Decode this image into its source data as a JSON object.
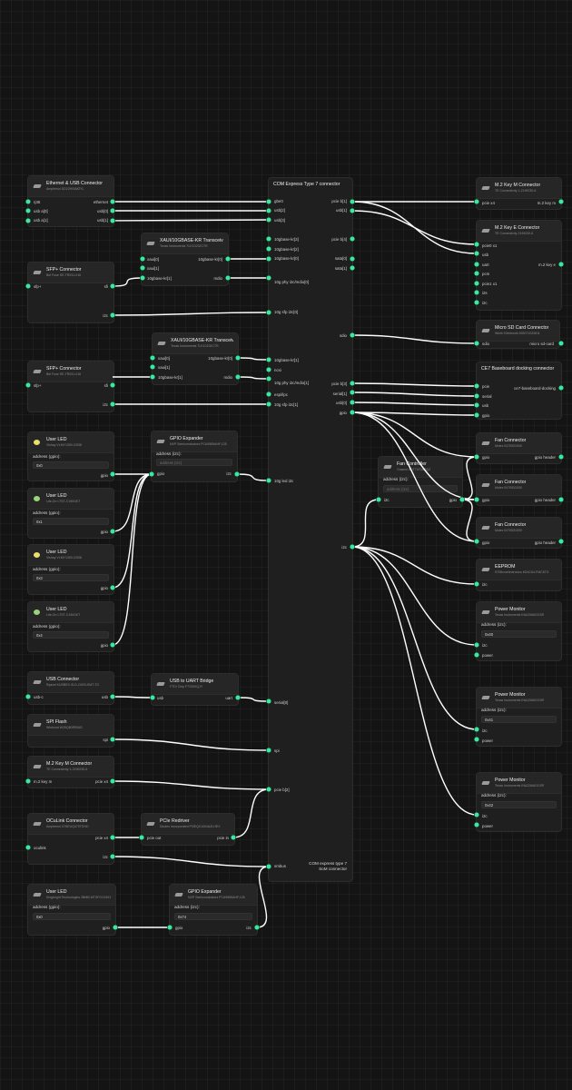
{
  "colors": {
    "wire": "#ffffff",
    "port": "#3ee6a0",
    "node_bg": "#1f1f1f",
    "canvas_bg": "#141414"
  },
  "nodes": {
    "com": {
      "title": "COM Express Type 7 connector",
      "left_ports": [
        "gbe0",
        "usb[2]",
        "usb[3]",
        "10gbase-kr[3]",
        "10gbase-kr[2]",
        "10gbase-kr[0]",
        "10g phy i2c/mdio[0]",
        "10g sfp i2c[0]",
        "10gbase-kr[1]",
        "ncsi",
        "10g phy i2c/mdio[1]",
        "espi/lpc",
        "10g sfp i2c[1]",
        "10g led i2c",
        "serial[0]",
        "spi",
        "pcie b[2]",
        "smbus"
      ],
      "right_ports": [
        "pcie b[1]",
        "usb[1]",
        "pcie b[4]",
        "sata[0]",
        "sata[1]",
        "sdio",
        "pcie b[3]",
        "serial[1]",
        "usb[0]",
        "gpio",
        "i2c"
      ],
      "footer": "COM express type 7 SoM connector"
    },
    "eth_usb": {
      "title": "Ethernet & USB Connector",
      "sub": "Amphenol DD22H04MZYL",
      "ports_left": [
        "rj45",
        "usb a[0]",
        "usb a[1]"
      ],
      "ports_right": [
        "ethernet",
        "usb[0]",
        "usb[1]"
      ]
    },
    "xaui0": {
      "title": "XAUI/10GBASE-KR Transceiver",
      "sub": "Texas Instruments TLK10232CTR",
      "ports_left": [
        "xaui[0]",
        "xaui[1]",
        "10gbase-kr[1]"
      ],
      "ports_right": [
        "10gbase-kr[0]",
        "mdio"
      ]
    },
    "sfp0": {
      "title": "SFP+ Connector",
      "sub": "Bel Fuse SE-TR031-016",
      "port_left": "sfp+",
      "ports_right": [
        "sfi",
        "i2c"
      ]
    },
    "xaui1": {
      "title": "XAUI/10GBASE-KR Transceiver",
      "sub": "Texas Instruments TLK10232CTR",
      "ports_left": [
        "xaui[0]",
        "xaui[1]",
        "10gbase-kr[1]"
      ],
      "ports_right": [
        "10gbase-kr[0]",
        "mdio"
      ]
    },
    "sfp1": {
      "title": "SFP+ Connector",
      "sub": "Bel Fuse SE-TR031-016",
      "port_left": "sfp+",
      "ports_right": [
        "sfi",
        "i2c"
      ]
    },
    "led1": {
      "title": "User LED",
      "sub": "Vishay VLMY1300-GS08",
      "label": "address (gpio):",
      "value": "0x0",
      "port": "gpio"
    },
    "gpioexp1": {
      "title": "GPIO Expander",
      "sub": "NXP Semiconductors PCA9555AHF,128",
      "label": "address (i2c):",
      "placeholder": "address (i2c)",
      "port_left": "gpio",
      "port_right": "i2c"
    },
    "led2": {
      "title": "User LED",
      "sub": "Lite-On LTST-C190GKT",
      "label": "address (gpio):",
      "value": "0x1",
      "port": "gpio"
    },
    "led3": {
      "title": "User LED",
      "sub": "Vishay VLMY1300-GS08",
      "label": "address (gpio):",
      "value": "0x3",
      "port": "gpio"
    },
    "led4": {
      "title": "User LED",
      "sub": "Lite-On LTST-C190GKT",
      "label": "address (gpio):",
      "value": "0x4",
      "port": "gpio"
    },
    "usbconn": {
      "title": "USB Connector",
      "sub": "Ryacel KUSBEX-SLD-CMSI-SMT-TO",
      "port_left": "usb-c",
      "port_right": "usb"
    },
    "usbuart": {
      "title": "USB to UART Bridge",
      "sub": "FTDI Chip FT230XQ-R",
      "port_left": "usb",
      "port_right": "uart"
    },
    "spiflash": {
      "title": "SPI Flash",
      "sub": "Winbond W25Q80RSNIG",
      "port_right": "spi"
    },
    "m2m_left": {
      "title": "M.2 Key M Connector",
      "sub": "TE Connectivity 1-2199230-6",
      "port_left": "m.2 key m",
      "port_right": "pcie x4"
    },
    "oculink": {
      "title": "OCuLink Connector",
      "sub": "Amphenol G76EUQ470TDHD",
      "port_left": "oculink",
      "ports_right": [
        "pcie x4",
        "i2c"
      ]
    },
    "redriver": {
      "title": "PCIe Redriver",
      "sub": "Diodes Incorporated PI3EQX1004AZLHEX",
      "port_left": "pcie out",
      "port_right": "pcie in"
    },
    "led5": {
      "title": "User LED",
      "sub": "Kingbright Technologies 2BMB-MTSFO1X401",
      "label": "address (gpio):",
      "value": "0x0",
      "port": "gpio"
    },
    "gpioexp2": {
      "title": "GPIO Expander",
      "sub": "NXP Semiconductors PCA9555AHF,128",
      "label": "address (i2c):",
      "value": "0x74",
      "port_left": "gpio",
      "port_right": "i2c"
    },
    "m2m_right": {
      "title": "M.2 Key M Connector",
      "sub": "TE Connectivity 1-2199230-6",
      "port_left": "pcie x4",
      "port_right": "m.2 key m"
    },
    "m2e": {
      "title": "M.2 Key E Connector",
      "sub": "TE Connectivity 2199230-6",
      "ports_left": [
        "pcie0 x1",
        "usb",
        "uart",
        "pcm",
        "pcie1 x1",
        "i2s",
        "i2c"
      ],
      "port_right": "m.2 key e"
    },
    "sdcard": {
      "title": "Micro SD Card Connector",
      "sub": "Würth Elektronik 693071020811",
      "port_left": "sdio",
      "port_right": "micro sd-card"
    },
    "ce7": {
      "title": "CE7 Baseboard docking connector",
      "ports_left": [
        "pcie",
        "serial",
        "usb",
        "gpio"
      ],
      "port_right": "ce7-baseboard-docking"
    },
    "fan1": {
      "title": "Fan Connector",
      "sub": "Molex 0470531000",
      "port_left": "gpio",
      "port_right": "gpio header"
    },
    "fan2": {
      "title": "Fan Connector",
      "sub": "Molex 0470531000",
      "port_left": "gpio",
      "port_right": "gpio header"
    },
    "fan3": {
      "title": "Fan Connector",
      "sub": "Molex 0470531000",
      "port_left": "gpio",
      "port_right": "gpio header"
    },
    "fanctrl": {
      "title": "Fan Controller",
      "sub": "Onsemi ADT7470ARQZ",
      "label": "address (i2c):",
      "placeholder": "address (i2c)",
      "port_left": "i2c",
      "port_right": "gpio"
    },
    "eeprom": {
      "title": "EEPROM",
      "sub": "STMicroelectronics M24C64-FMC6TG",
      "port_left": "i2c"
    },
    "pm1": {
      "title": "Power Monitor",
      "sub": "Texas Instruments INA226AIDGSR",
      "label": "address (i2c):",
      "value": "0x40",
      "ports_left": [
        "i2c",
        "power"
      ]
    },
    "pm2": {
      "title": "Power Monitor",
      "sub": "Texas Instruments INA226AIDGSR",
      "label": "address (i2c):",
      "value": "0x41",
      "ports_left": [
        "i2c",
        "power"
      ]
    },
    "pm3": {
      "title": "Power Monitor",
      "sub": "Texas Instruments INA226AIDGSR",
      "label": "address (i2c):",
      "value": "0x42",
      "ports_left": [
        "i2c",
        "power"
      ]
    }
  }
}
